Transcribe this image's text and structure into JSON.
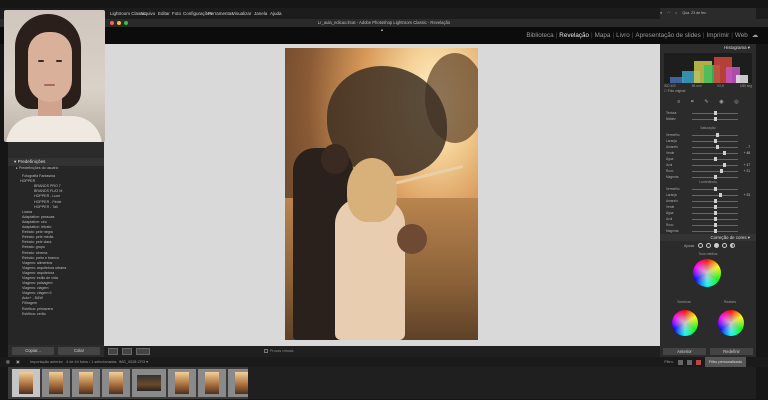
{
  "menubar": {
    "items": [
      "Lightroom Classic",
      "Arquivo",
      "Editar",
      "Foto",
      "Configurações",
      "Ferramentas",
      "Visualizar",
      "Janela",
      "Ajuda"
    ],
    "clock": "Qua. 23 de fev."
  },
  "window": {
    "title": "Lr_aula_edicao.lrcat - Adobe Photoshop Lightroom Classic - Revelação"
  },
  "modules": {
    "items": [
      {
        "label": "Biblioteca"
      },
      {
        "label": "Revelação"
      },
      {
        "label": "Mapa"
      },
      {
        "label": "Livro"
      },
      {
        "label": "Apresentação de slides"
      },
      {
        "label": "Imprimir"
      },
      {
        "label": "Web"
      }
    ],
    "active": "Revelação"
  },
  "left_panel": {
    "presets_header": "Predefinições",
    "user_presets_label": "Predefinições do usuário",
    "items": [
      {
        "label": "Fotografia Fantasma",
        "kind": "group"
      },
      {
        "label": "HOPPER",
        "kind": "open"
      },
      {
        "label": "BRANDS PRO 7",
        "kind": "sub"
      },
      {
        "label": "BRANDS FLAT M",
        "kind": "sub"
      },
      {
        "label": "HOPPER - Luxe",
        "kind": "sub"
      },
      {
        "label": "HOPPER - Finde",
        "kind": "sub"
      },
      {
        "label": "HOPPER - Tall",
        "kind": "sub"
      },
      {
        "label": "Luana",
        "kind": "group"
      },
      {
        "label": "Adaptative: pessoas",
        "kind": "group"
      },
      {
        "label": "Adaptative: céu",
        "kind": "group"
      },
      {
        "label": "Adaptative: retrato",
        "kind": "group"
      },
      {
        "label": "Retrato: pele negra",
        "kind": "group"
      },
      {
        "label": "Retrato: pele média",
        "kind": "group"
      },
      {
        "label": "Retrato: pele clara",
        "kind": "group"
      },
      {
        "label": "Retrato: grupo",
        "kind": "group"
      },
      {
        "label": "Retrato: cinema",
        "kind": "group"
      },
      {
        "label": "Retrato: preto e branco",
        "kind": "group"
      },
      {
        "label": "Viagens: alimentos",
        "kind": "group"
      },
      {
        "label": "Viagens: arquitetura urbana",
        "kind": "group"
      },
      {
        "label": "Viagens: arquitetura",
        "kind": "group"
      },
      {
        "label": "Viagens: estilo de vida",
        "kind": "group"
      },
      {
        "label": "Viagens: paisagem",
        "kind": "group"
      },
      {
        "label": "Viagens: viagem",
        "kind": "group"
      },
      {
        "label": "Viagens: viagem II",
        "kind": "group"
      },
      {
        "label": "Auto+ - B&W",
        "kind": "group"
      },
      {
        "label": "Filtragem",
        "kind": "group"
      },
      {
        "label": "Estética: primavera",
        "kind": "group"
      },
      {
        "label": "Estética: verão",
        "kind": "group"
      }
    ],
    "copy_label": "Copiar...",
    "paste_label": "Colar"
  },
  "toolbar": {
    "before_after_label": "Provas virtuais"
  },
  "right_panel": {
    "histogram_header": "Histograma",
    "hist_meta_left": "ISO 400",
    "hist_meta_mid": "85 mm",
    "hist_meta_mid2": "f/2,8",
    "hist_meta_right": "1/80 seg",
    "original_photo_label": "Foto original",
    "sections": {
      "presence": "Presença",
      "tone": "Saturação",
      "luminance": "Luminância"
    },
    "sliders_top": [
      {
        "label": "Textura",
        "pos": 0.52,
        "value": ""
      },
      {
        "label": "Nitidez",
        "pos": 0.5,
        "value": ""
      }
    ],
    "sliders_hue": [
      {
        "label": "Vermelho",
        "pos": 0.55,
        "value": ""
      },
      {
        "label": "Laranja",
        "pos": 0.5,
        "value": ""
      },
      {
        "label": "Amarelo",
        "pos": 0.55,
        "value": "- 7"
      },
      {
        "label": "Verde",
        "pos": 0.7,
        "value": "+ 48"
      },
      {
        "label": "Água",
        "pos": 0.5,
        "value": ""
      },
      {
        "label": "Azul",
        "pos": 0.7,
        "value": "+ 17"
      },
      {
        "label": "Roxo",
        "pos": 0.65,
        "value": "+ 21"
      },
      {
        "label": "Magenta",
        "pos": 0.5,
        "value": ""
      }
    ],
    "sliders_lum": [
      {
        "label": "Vermelho",
        "pos": 0.5,
        "value": ""
      },
      {
        "label": "Laranja",
        "pos": 0.62,
        "value": "+ 23"
      },
      {
        "label": "Amarelo",
        "pos": 0.5,
        "value": ""
      },
      {
        "label": "Verde",
        "pos": 0.5,
        "value": ""
      },
      {
        "label": "Água",
        "pos": 0.5,
        "value": ""
      },
      {
        "label": "Azul",
        "pos": 0.5,
        "value": ""
      },
      {
        "label": "Roxo",
        "pos": 0.5,
        "value": ""
      },
      {
        "label": "Magenta",
        "pos": 0.5,
        "value": ""
      }
    ],
    "color_grading_header": "Correção de cores",
    "adjust_label": "Ajustar",
    "midtones_label": "Tons médios",
    "shadows_label": "Sombras",
    "highlights_label": "Realces",
    "previous_label": "Anterior",
    "reset_label": "Redefinir"
  },
  "filmstrip": {
    "source_label": "Importação anterior",
    "count_label": "4 de 44 fotos / 1 selecionadas",
    "filename_label": "IMG_0528.CR3",
    "filter_label": "Filtro:",
    "filter_value": "Filtro personalizado",
    "thumbs": [
      {
        "kind": "portrait",
        "selected": true
      },
      {
        "kind": "portrait",
        "selected": false
      },
      {
        "kind": "portrait",
        "selected": false
      },
      {
        "kind": "portrait",
        "selected": false
      },
      {
        "kind": "wide",
        "selected": false
      },
      {
        "kind": "portrait",
        "selected": false
      },
      {
        "kind": "portrait",
        "selected": false
      },
      {
        "kind": "portrait",
        "selected": false
      }
    ]
  },
  "colors": {
    "accent_active": "#e8e8e8",
    "panel_bg": "#2b2b2b",
    "canvas_bg": "#d9d9d9"
  }
}
